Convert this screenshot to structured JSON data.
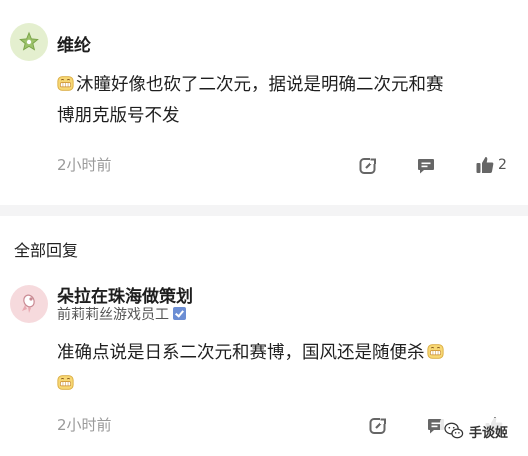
{
  "comment": {
    "author": "维纶",
    "text_line1": "沐瞳好像也砍了二次元，据说是明确二次元和赛",
    "text_line2": "博朋克版号不发",
    "time": "2小时前",
    "like_count": "2",
    "emoji_name": "grinning-face-emoji"
  },
  "replies_section": {
    "title": "全部回复"
  },
  "reply": {
    "author": "朵拉在珠海做策划",
    "subtitle": "前莉莉丝游戏员工",
    "text_line1": "准确点说是日系二次元和赛博，国风还是随便杀",
    "time": "2小时前"
  },
  "watermark": {
    "text": "手谈姬"
  },
  "colors": {
    "avatar1_bg": "#e6f0d2",
    "avatar2_bg": "#f6dcdf",
    "divider": "#f4f4f5",
    "muted_text": "#9a9a9a",
    "verified_badge": "#6c8ed4"
  }
}
